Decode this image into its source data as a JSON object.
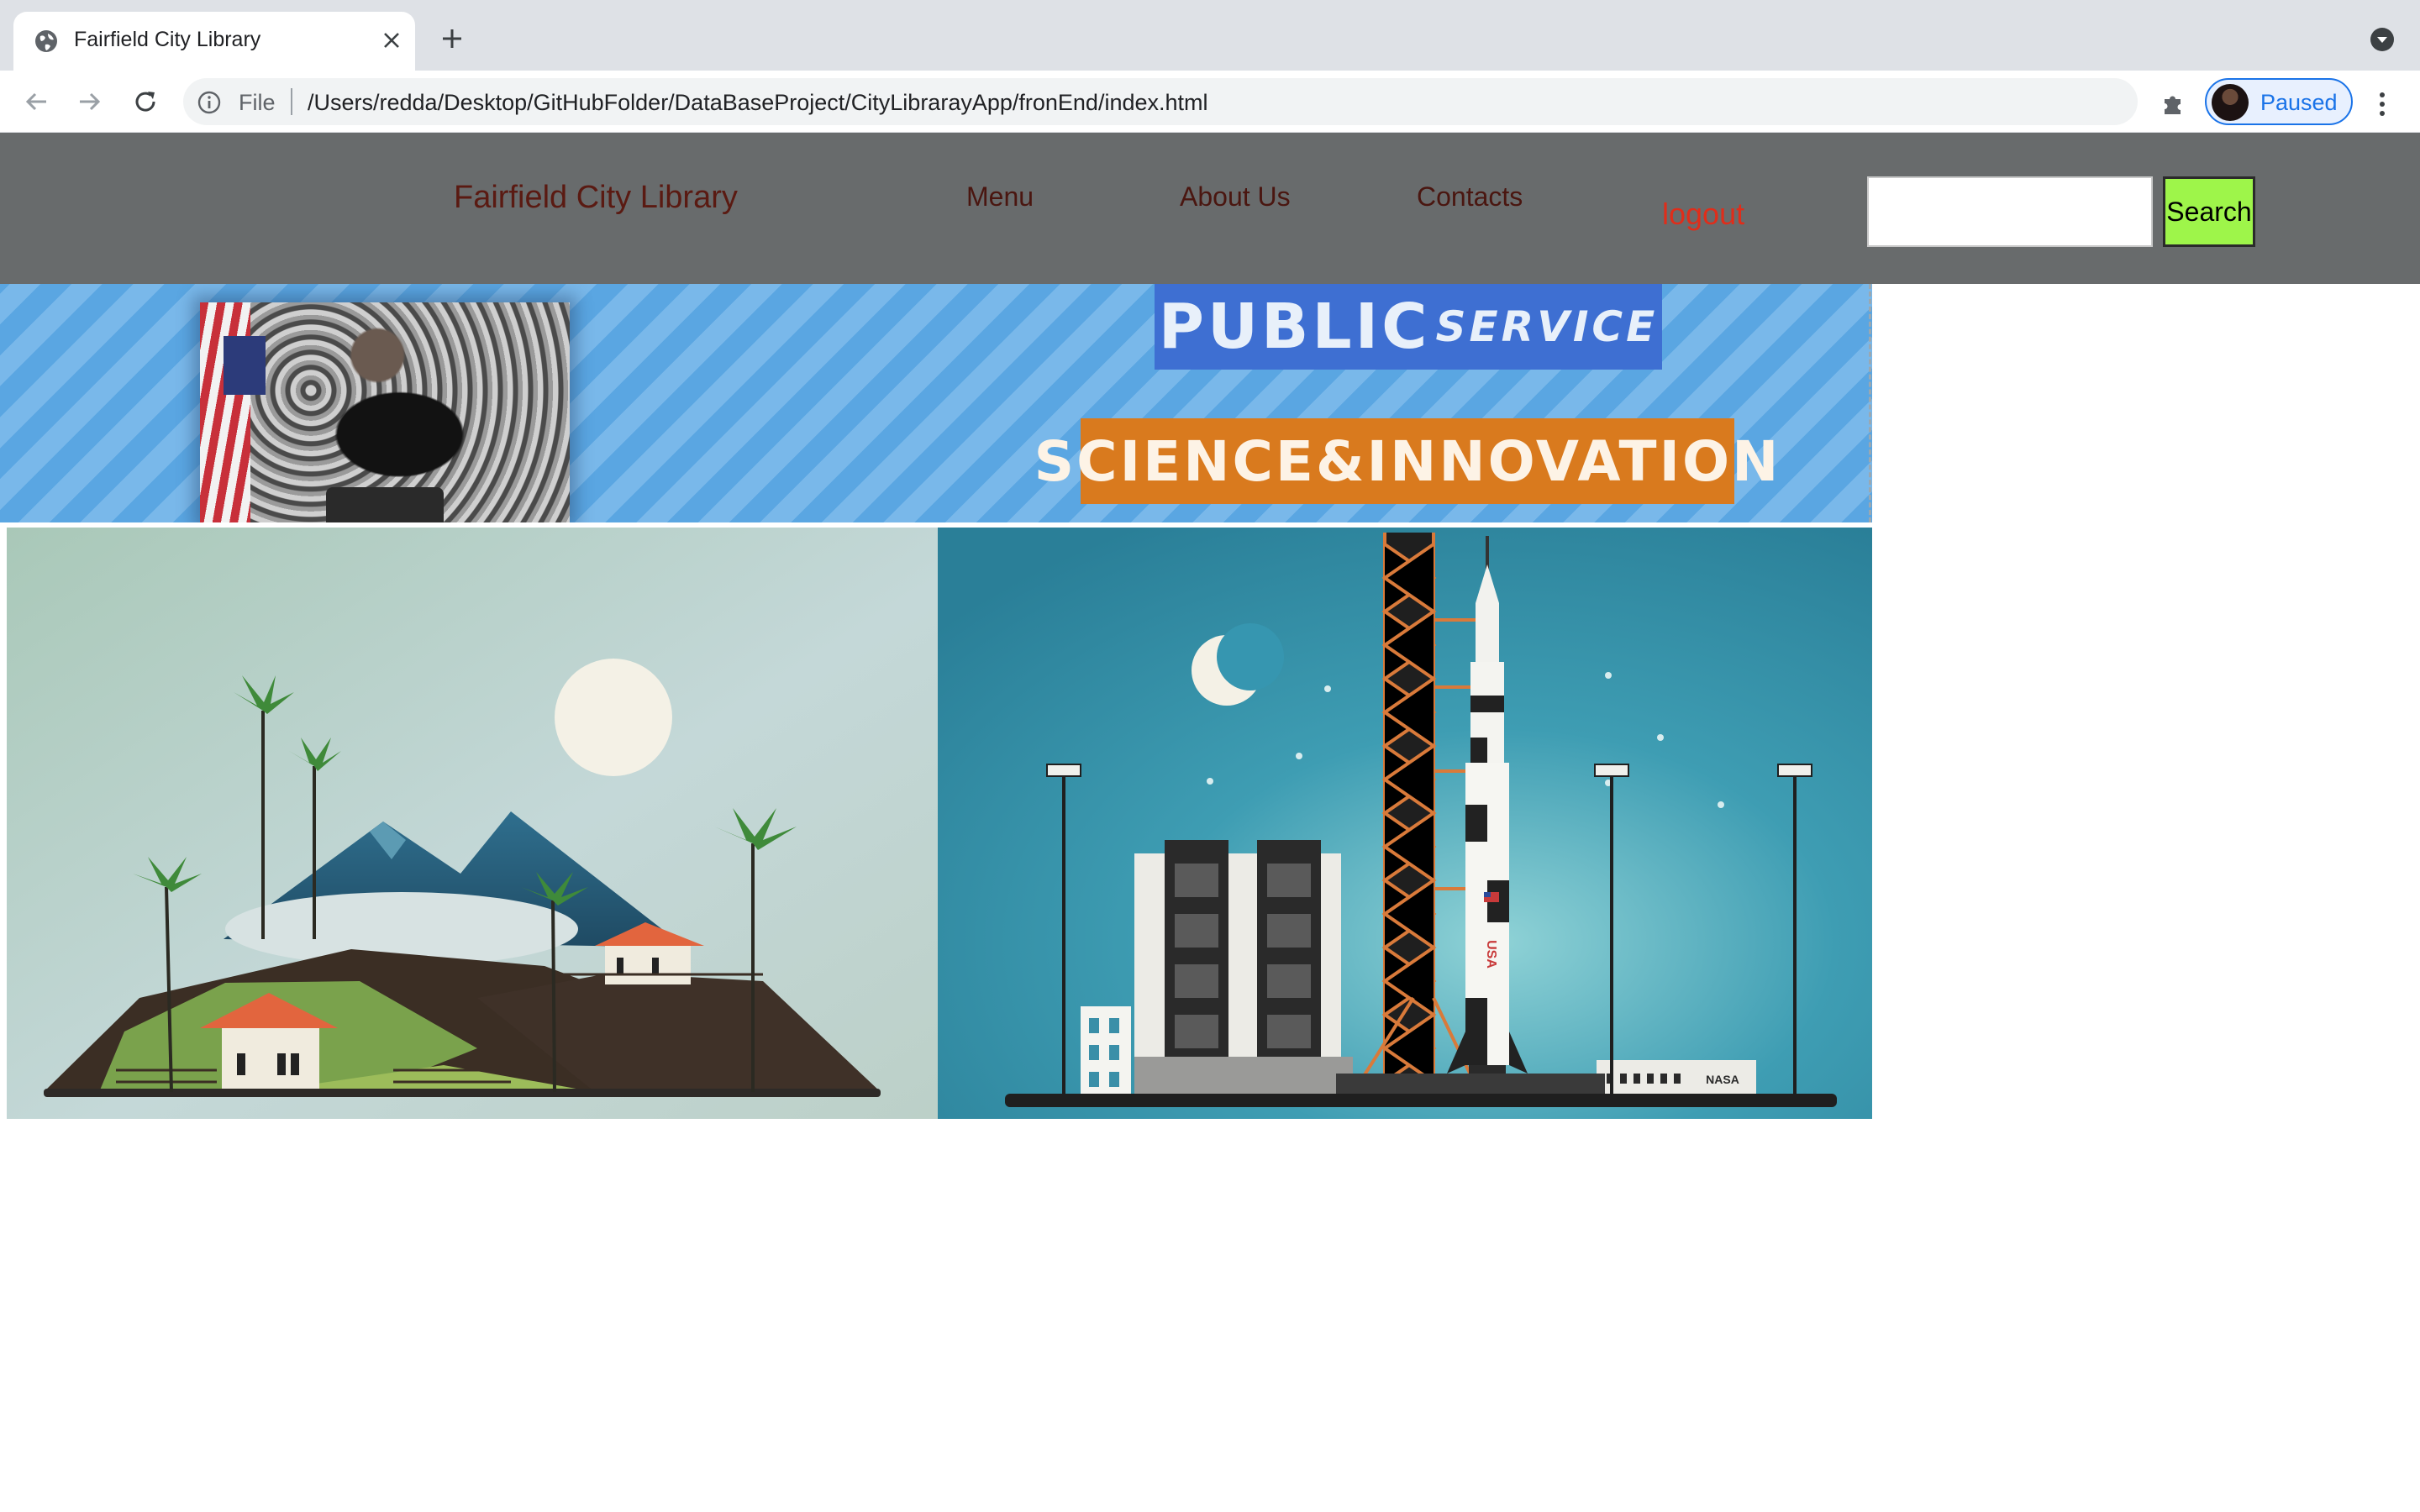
{
  "browser": {
    "tab": {
      "title": "Fairfield City Library"
    },
    "address_bar": {
      "scheme_label": "File",
      "url": "/Users/redda/Desktop/GitHubFolder/DataBaseProject/CityLibrarayApp/fronEnd/index.html"
    },
    "profile": {
      "label": "Paused"
    },
    "icons": [
      "globe-icon",
      "close-icon",
      "plus-icon",
      "chevron-down-icon",
      "back-arrow-icon",
      "forward-arrow-icon",
      "reload-icon",
      "info-icon",
      "star-icon",
      "puzzle-icon",
      "kebab-menu-icon"
    ]
  },
  "site": {
    "brand": "Fairfield City Library",
    "nav": {
      "menu": "Menu",
      "about": "About Us",
      "contacts": "Contacts",
      "logout": "logout"
    },
    "search": {
      "value": "",
      "button_label": "Search"
    }
  },
  "banner": {
    "public_big": "PUBLIC",
    "public_small": "SERVICE",
    "science": "SCIENCE&INNOVATION"
  },
  "illustration": {
    "rocket_text": "USA",
    "building_text": "NASA"
  },
  "colors": {
    "header_bg": "#686b6c",
    "brand_text": "#5a1a12",
    "logout_text": "#e02d1a",
    "search_button_bg": "#9ef54a",
    "banner_blue": "#5aa6e2",
    "public_box": "#3e6fd2",
    "science_box": "#d97a1e",
    "profile_accent": "#1a73e8"
  }
}
